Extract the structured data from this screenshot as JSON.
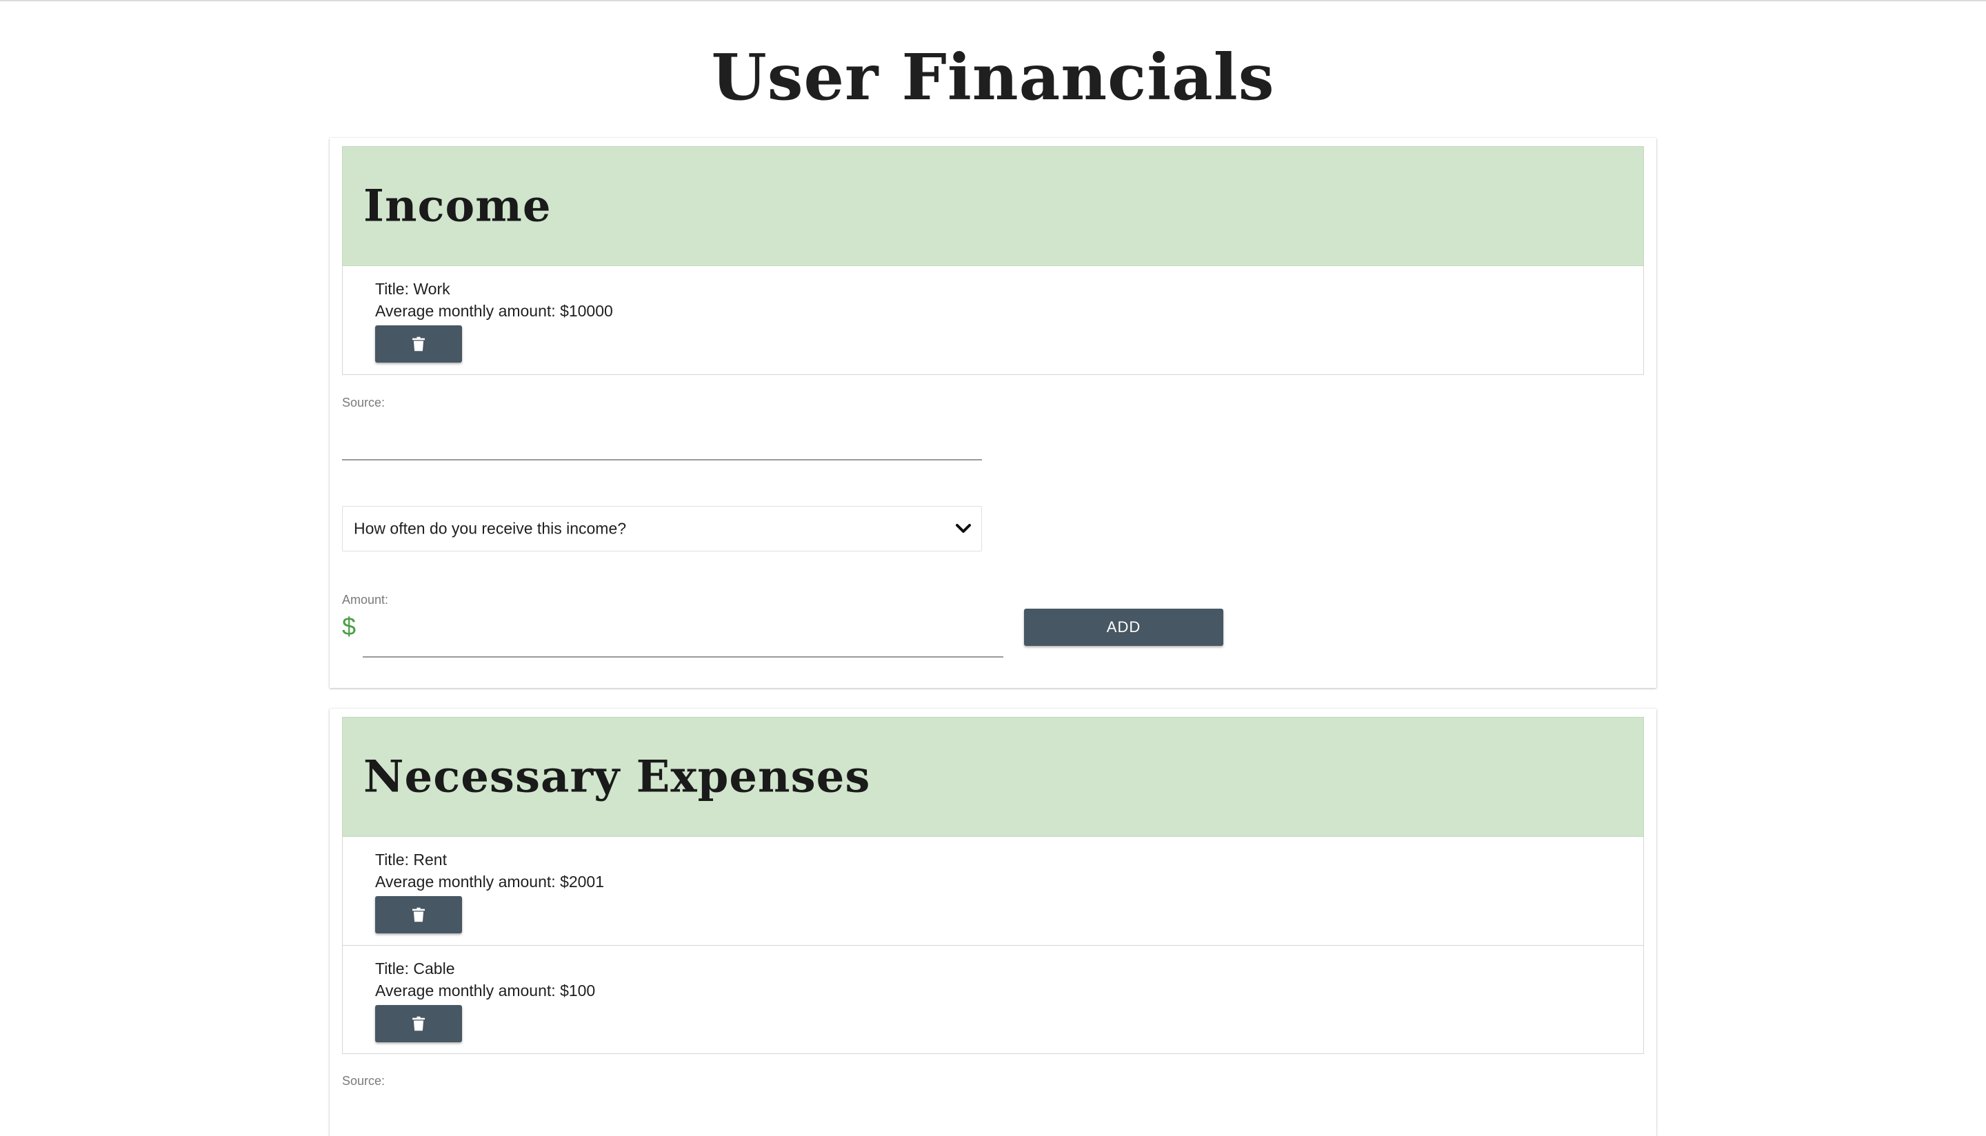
{
  "page": {
    "title": "User Financials"
  },
  "income": {
    "heading": "Income",
    "items": [
      {
        "title_label": "Title:",
        "title": "Work",
        "amount_label": "Average monthly amount:",
        "amount": "$10000"
      }
    ],
    "form": {
      "source_label": "Source:",
      "source_value": "",
      "frequency_select": "How often do you receive this income?",
      "amount_label": "Amount:",
      "currency_symbol": "$",
      "amount_value": "",
      "add_label": "ADD"
    }
  },
  "expenses": {
    "heading": "Necessary Expenses",
    "items": [
      {
        "title_label": "Title:",
        "title": "Rent",
        "amount_label": "Average monthly amount:",
        "amount": "$2001"
      },
      {
        "title_label": "Title:",
        "title": "Cable",
        "amount_label": "Average monthly amount:",
        "amount": "$100"
      }
    ],
    "form": {
      "source_label": "Source:"
    }
  },
  "icons": {
    "delete": "trash-icon",
    "dropdown": "chevron-down-icon"
  },
  "colors": {
    "header_bg": "#d0e5cc",
    "button_bg": "#475763",
    "currency_accent": "#4a9e45"
  }
}
